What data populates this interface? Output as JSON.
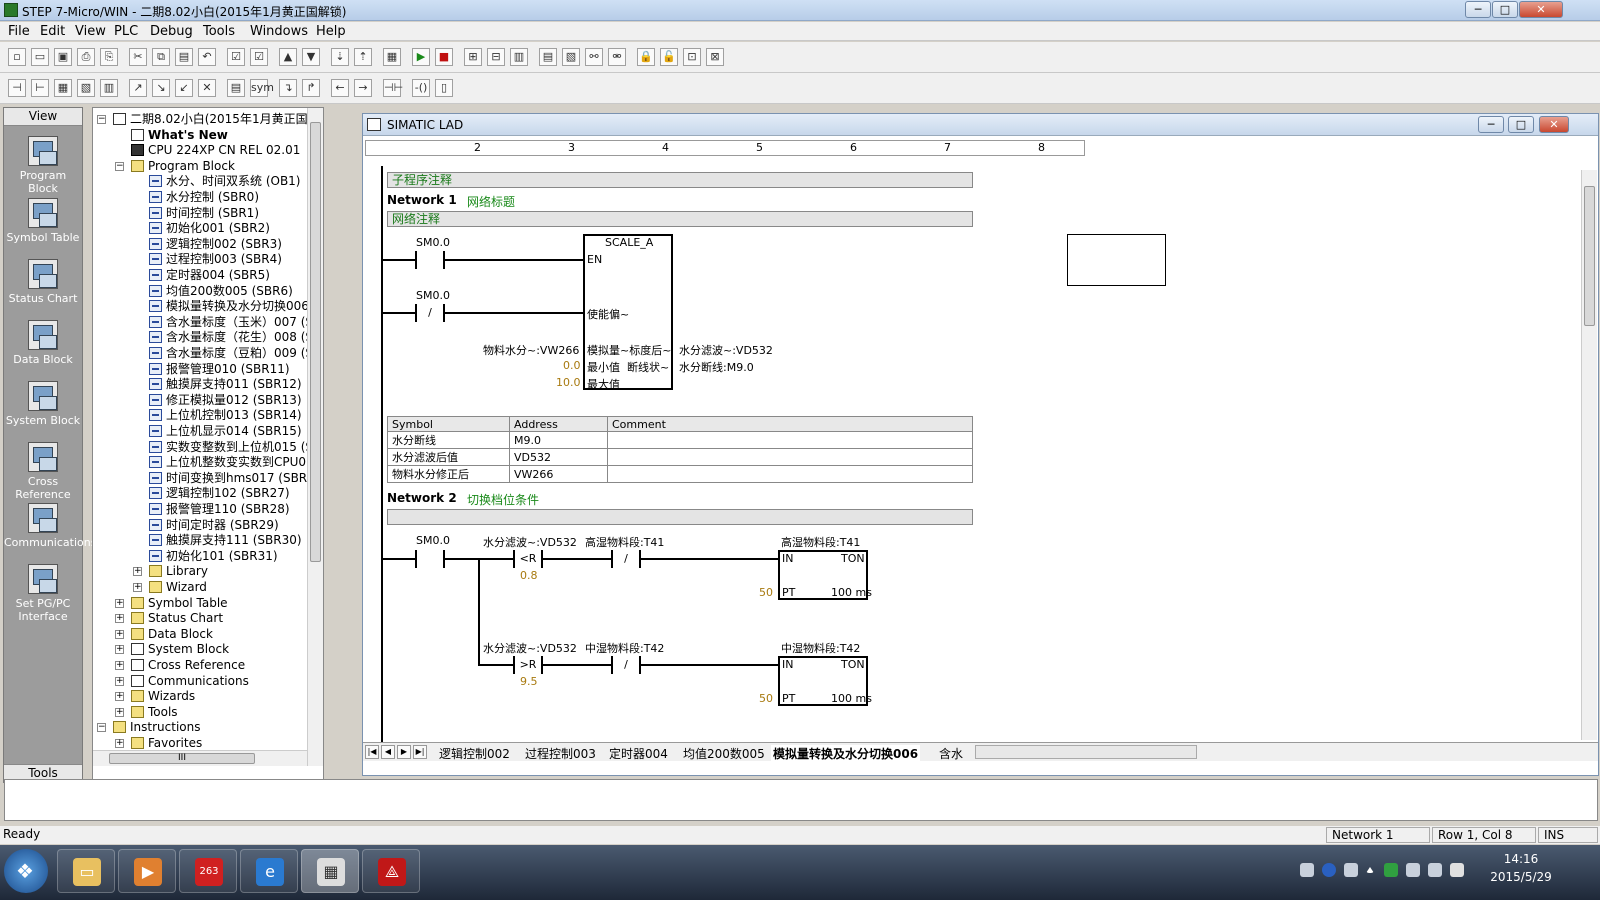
{
  "window": {
    "title": "STEP 7-Micro/WIN - 二期8.02小白(2015年1月黄正国解锁)",
    "min": "─",
    "max": "□",
    "close": "✕"
  },
  "menu": [
    "File",
    "Edit",
    "View",
    "PLC",
    "Debug",
    "Tools",
    "Windows",
    "Help"
  ],
  "toolbar1": [
    "new-icon",
    "open-icon",
    "save-all-icon",
    "print-icon",
    "print-preview-icon",
    "cut-icon",
    "copy-icon",
    "paste-icon",
    "undo-icon",
    "compile-icon",
    "compile-all-icon",
    "upload-icon",
    "download-icon",
    "sort-asc-icon",
    "sort-desc-icon",
    "options-icon",
    "run-icon",
    "stop-icon",
    "program-status-icon",
    "chart-status-icon",
    "pause-icon",
    "single-read-icon",
    "write-all-icon",
    "force-icon",
    "unforce-icon",
    "lock-icon",
    "unlock-icon",
    "read-force-icon",
    "unforce-all-icon"
  ],
  "toolbar1_glyphs": [
    "▫",
    "▭",
    "▣",
    "⎙",
    "⎘",
    "✂",
    "⧉",
    "▤",
    "↶",
    "☑",
    "☑",
    "▲",
    "▼",
    "⇣",
    "⇡",
    "▦",
    "▶",
    "■",
    "⊞",
    "⊟",
    "▥",
    "▤",
    "▧",
    "⚯",
    "⚮",
    "🔒",
    "🔓",
    "⊡",
    "⊠"
  ],
  "toolbar2": [
    "insert-network-icon",
    "delete-network-icon",
    "toggle-poi-icon",
    "toggle-trend-icon",
    "table-icon",
    "bookmark-icon",
    "next-bookmark-icon",
    "prev-bookmark-icon",
    "remove-bookmarks-icon",
    "symbol-table-icon",
    "sym-icon",
    "down-line-icon",
    "up-line-icon",
    "left-line-icon",
    "right-line-icon",
    "contact-icon",
    "coil-icon",
    "box-icon"
  ],
  "toolbar2_glyphs": [
    "⊣",
    "⊢",
    "▦",
    "▧",
    "▥",
    "↗",
    "↘",
    "↙",
    "✕",
    "▤",
    "sym",
    "↴",
    "↱",
    "←",
    "→",
    "⊣⊢",
    "-()",
    "▯"
  ],
  "viewbar": {
    "header": "View",
    "footer": "Tools",
    "items": [
      "Program Block",
      "Symbol Table",
      "Status Chart",
      "Data Block",
      "System Block",
      "Cross Reference",
      "Communications",
      "Set PG/PC Interface"
    ]
  },
  "tree": [
    {
      "label": "二期8.02小白(2015年1月黄正国解锁)",
      "indent": 0,
      "box": "−",
      "icon": "doc"
    },
    {
      "label": "What's New",
      "indent": 1,
      "icon": "doc",
      "bold": true
    },
    {
      "label": "CPU 224XP CN REL 02.01",
      "indent": 1,
      "icon": "cpu"
    },
    {
      "label": "Program Block",
      "indent": 1,
      "box": "−",
      "icon": "fold"
    },
    {
      "label": "水分、时间双系统 (OB1)",
      "indent": 2,
      "icon": "sub"
    },
    {
      "label": "水分控制 (SBR0)",
      "indent": 2,
      "icon": "sub"
    },
    {
      "label": "时间控制 (SBR1)",
      "indent": 2,
      "icon": "sub"
    },
    {
      "label": "初始化001 (SBR2)",
      "indent": 2,
      "icon": "sub"
    },
    {
      "label": "逻辑控制002 (SBR3)",
      "indent": 2,
      "icon": "sub"
    },
    {
      "label": "过程控制003 (SBR4)",
      "indent": 2,
      "icon": "sub"
    },
    {
      "label": "定时器004 (SBR5)",
      "indent": 2,
      "icon": "sub"
    },
    {
      "label": "均值200数005 (SBR6)",
      "indent": 2,
      "icon": "sub"
    },
    {
      "label": "模拟量转换及水分切换006",
      "indent": 2,
      "icon": "sub"
    },
    {
      "label": "含水量标度（玉米）007 (S",
      "indent": 2,
      "icon": "sub"
    },
    {
      "label": "含水量标度（花生）008 (S",
      "indent": 2,
      "icon": "sub"
    },
    {
      "label": "含水量标度（豆粕）009 (S",
      "indent": 2,
      "icon": "sub"
    },
    {
      "label": "报警管理010 (SBR11)",
      "indent": 2,
      "icon": "sub"
    },
    {
      "label": "触摸屏支持011 (SBR12)",
      "indent": 2,
      "icon": "sub"
    },
    {
      "label": "修正模拟量012 (SBR13)",
      "indent": 2,
      "icon": "sub"
    },
    {
      "label": "上位机控制013 (SBR14)",
      "indent": 2,
      "icon": "sub"
    },
    {
      "label": "上位机显示014 (SBR15)",
      "indent": 2,
      "icon": "sub"
    },
    {
      "label": "实数变整数到上位机015 (S",
      "indent": 2,
      "icon": "sub"
    },
    {
      "label": "上位机整数变实数到CPU0",
      "indent": 2,
      "icon": "sub"
    },
    {
      "label": "时间变换到hms017 (SBR18",
      "indent": 2,
      "icon": "sub"
    },
    {
      "label": "逻辑控制102 (SBR27)",
      "indent": 2,
      "icon": "sub"
    },
    {
      "label": "报警管理110 (SBR28)",
      "indent": 2,
      "icon": "sub"
    },
    {
      "label": "时间定时器 (SBR29)",
      "indent": 2,
      "icon": "sub"
    },
    {
      "label": "触摸屏支持111 (SBR30)",
      "indent": 2,
      "icon": "sub"
    },
    {
      "label": "初始化101 (SBR31)",
      "indent": 2,
      "icon": "sub"
    },
    {
      "label": "Library",
      "indent": 2,
      "box": "+",
      "icon": "fold"
    },
    {
      "label": "Wizard",
      "indent": 2,
      "box": "+",
      "icon": "fold"
    },
    {
      "label": "Symbol Table",
      "indent": 1,
      "box": "+",
      "icon": "fold"
    },
    {
      "label": "Status Chart",
      "indent": 1,
      "box": "+",
      "icon": "fold"
    },
    {
      "label": "Data Block",
      "indent": 1,
      "box": "+",
      "icon": "fold"
    },
    {
      "label": "System Block",
      "indent": 1,
      "box": "+",
      "icon": "doc"
    },
    {
      "label": "Cross Reference",
      "indent": 1,
      "box": "+",
      "icon": "doc"
    },
    {
      "label": "Communications",
      "indent": 1,
      "box": "+",
      "icon": "doc"
    },
    {
      "label": "Wizards",
      "indent": 1,
      "box": "+",
      "icon": "fold"
    },
    {
      "label": "Tools",
      "indent": 1,
      "box": "+",
      "icon": "fold"
    },
    {
      "label": "Instructions",
      "indent": 0,
      "box": "−",
      "icon": "fold"
    },
    {
      "label": "Favorites",
      "indent": 1,
      "box": "+",
      "icon": "fold"
    }
  ],
  "tree_hscroll": "III",
  "lad": {
    "title": "SIMATIC LAD",
    "ruler": [
      "2",
      "3",
      "4",
      "5",
      "6",
      "7",
      "8"
    ],
    "sub_comment": "子程序注释",
    "network1": {
      "label": "Network 1",
      "title": "网络标题",
      "comment": "网络注释",
      "c1": "SM0.0",
      "c2": "SM0.0",
      "c2_sym": "/",
      "box_name": "SCALE_A",
      "pin_en": "EN",
      "pin_in2": "使能偏~",
      "pin_in": "模拟量~标度后~",
      "pin_min": "最小值",
      "pin_max": "最大值",
      "pin_out2": "断线状~",
      "in_op": "物料水分~:VW266",
      "min_val": "0.0",
      "max_val": "10.0",
      "out_op": "水分滤波~:VD532",
      "out2_op": "水分断线:M9.0"
    },
    "symtable": {
      "headers": [
        "Symbol",
        "Address",
        "Comment"
      ],
      "rows": [
        [
          "水分断线",
          "M9.0",
          ""
        ],
        [
          "水分滤波后值",
          "VD532",
          ""
        ],
        [
          "物料水分修正后",
          "VW266",
          ""
        ]
      ]
    },
    "network2": {
      "label": "Network 2",
      "title": "切换档位条件",
      "c1": "SM0.0",
      "cmp1_top": "水分滤波~:VD532",
      "cmp1_op": "<R",
      "cmp1_val": "0.8",
      "t41_top": "高湿物料段:T41",
      "t41_sym": "/",
      "timer1_name": "高湿物料段:T41",
      "timer1_in": "IN",
      "timer1_type": "TON",
      "timer1_pt": "PT",
      "timer1_res": "100 ms",
      "timer1_ptval": "50",
      "cmp2_top": "水分滤波~:VD532",
      "cmp2_op": ">R",
      "cmp2_val": "9.5",
      "t42_top": "中湿物料段:T42",
      "t42_sym": "/",
      "timer2_name": "中湿物料段:T42",
      "timer2_in": "IN",
      "timer2_type": "TON",
      "timer2_pt": "PT",
      "timer2_res": "100 ms",
      "timer2_ptval": "50"
    }
  },
  "tabs": [
    "逻辑控制002",
    "过程控制003",
    "定时器004",
    "均值200数005",
    "模拟量转换及水分切换006",
    "含水"
  ],
  "nav": [
    "|◀",
    "◀",
    "▶",
    "▶|"
  ],
  "status": {
    "ready": "Ready",
    "network": "Network 1",
    "rowcol": "Row 1, Col 8",
    "ins": "INS"
  },
  "taskbar": {
    "time": "14:16",
    "date": "2015/5/29"
  },
  "taskbar_glyphs": [
    "❖",
    "▭",
    "▶",
    "263",
    "e",
    "▦",
    "⟁"
  ]
}
